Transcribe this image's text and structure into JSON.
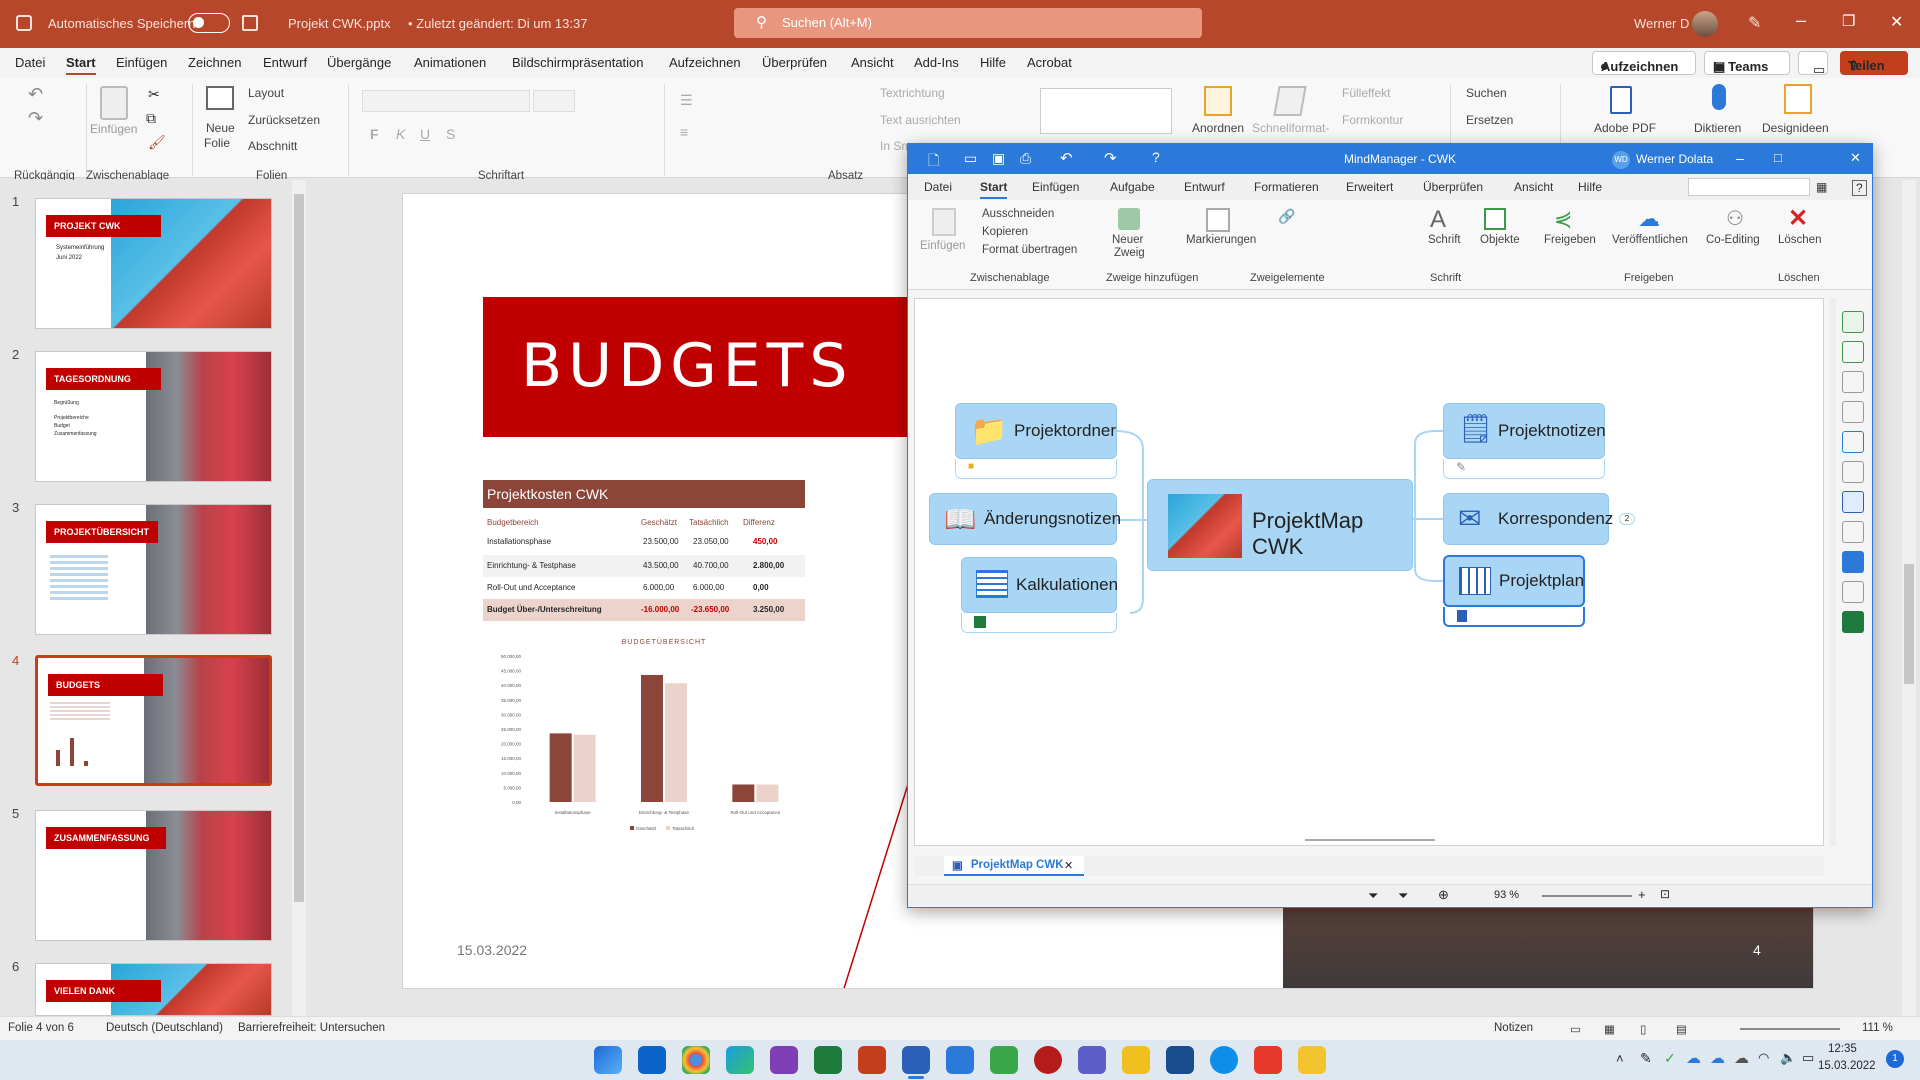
{
  "powerpoint": {
    "autosave_label": "Automatisches Speichern",
    "filename": "Projekt CWK.pptx",
    "last_changed": "• Zuletzt geändert: Di um 13:37",
    "search_placeholder": "Suchen (Alt+M)",
    "user": "Werner D",
    "tabs": [
      "Datei",
      "Start",
      "Einfügen",
      "Zeichnen",
      "Entwurf",
      "Übergänge",
      "Animationen",
      "Bildschirmpräsentation",
      "Aufzeichnen",
      "Überprüfen",
      "Ansicht",
      "Add-Ins",
      "Hilfe",
      "Acrobat"
    ],
    "record_button": "Aufzeichnen",
    "teams_button": "In Teams",
    "share_button": "Teilen",
    "ribbon": {
      "undo_group": "Rückgängig",
      "paste_label": "Einfügen",
      "clipboard_group": "Zwischenablage",
      "new_slide": "Neue",
      "new_slide2": "Folie",
      "layout": "Layout",
      "reset": "Zurücksetzen",
      "section": "Abschnitt",
      "slides_group": "Folien",
      "font_group": "Schriftart",
      "paragraph_group": "Absatz",
      "text_direction": "Textrichtung",
      "align_text": "Text ausrichten",
      "convert_smartart": "In Sm",
      "arrange": "Anordnen",
      "quick_format": "Schnellformat-",
      "fill_effect": "Fülleffekt",
      "outline": "Formkontur",
      "search": "Suchen",
      "replace": "Ersetzen",
      "adobe_pdf": "Adobe PDF",
      "dictate": "Diktieren",
      "designer": "Designideen"
    },
    "thumbnails": [
      {
        "num": "1",
        "title": "PROJEKT CWK",
        "lines": [
          "Systemeinführung",
          "Juni 2022"
        ]
      },
      {
        "num": "2",
        "title": "TAGESORDNUNG",
        "lines": [
          "Begrüßung",
          "Projektbereiche",
          "Budget",
          "Zusammenfassung"
        ]
      },
      {
        "num": "3",
        "title": "PROJEKTÜBERSICHT",
        "lines": []
      },
      {
        "num": "4",
        "title": "BUDGETS",
        "lines": []
      },
      {
        "num": "5",
        "title": "ZUSAMMENFASSUNG",
        "lines": []
      },
      {
        "num": "6",
        "title": "VIELEN DANK",
        "lines": []
      }
    ],
    "slide": {
      "title": "BUDGETS",
      "table_title": "Projektkosten CWK",
      "columns": [
        "Budgetbereich",
        "Geschätzt",
        "Tatsächlich",
        "Differenz"
      ],
      "rows": [
        [
          "Installationsphase",
          "23.500,00",
          "23.050,00",
          "450,00"
        ],
        [
          "Einrichtung- & Testphase",
          "43.500,00",
          "40.700,00",
          "2.800,00"
        ],
        [
          "Roll-Out und Acceptance",
          "6.000,00",
          "6.000,00",
          "0,00"
        ],
        [
          "Budget Über-/Unterschreitung",
          "-16.000,00",
          "-23.650,00",
          "3.250,00"
        ]
      ],
      "date": "15.03.2022",
      "page": "4"
    },
    "status": {
      "slide_of": "Folie 4 von 6",
      "language": "Deutsch (Deutschland)",
      "accessibility": "Barrierefreiheit: Untersuchen",
      "notes": "Notizen",
      "zoom": "111 %"
    }
  },
  "chart_data": {
    "type": "bar",
    "title": "BUDGETÜBERSICHT",
    "categories": [
      "Installationsphase",
      "Einrichtung- & Testphase",
      "Roll-Out und Acceptance"
    ],
    "series": [
      {
        "name": "Geschätzt",
        "values": [
          23500,
          43500,
          6000
        ],
        "color": "#8b4539"
      },
      {
        "name": "Tatsächlich",
        "values": [
          23050,
          40700,
          6000
        ],
        "color": "#ebd3cc"
      }
    ],
    "ylim": [
      0,
      50000
    ],
    "yticks": [
      "50.000,00",
      "45.000,00",
      "40.000,00",
      "35.000,00",
      "30.000,00",
      "25.000,00",
      "20.000,00",
      "15.000,00",
      "10.000,00",
      "5.000,00",
      "0,00"
    ],
    "legend": "bottom"
  },
  "mindmanager": {
    "title": "MindManager - CWK",
    "user_initials": "WD",
    "user": "Werner Dolata",
    "tabs": [
      "Datei",
      "Start",
      "Einfügen",
      "Aufgabe",
      "Entwurf",
      "Formatieren",
      "Erweitert",
      "Überprüfen",
      "Ansicht",
      "Hilfe"
    ],
    "ribbon": {
      "paste": "Einfügen",
      "cut": "Ausschneiden",
      "copy": "Kopieren",
      "format_painter": "Format übertragen",
      "clipboard_group": "Zwischenablage",
      "new_branch": "Neuer",
      "new_branch2": "Zweig",
      "add_branches_group": "Zweige hinzufügen",
      "markers": "Markierungen",
      "branch_elements_group": "Zweigelemente",
      "font": "Schrift",
      "font_group": "Schrift",
      "objects": "Objekte",
      "share": "Freigeben",
      "publish": "Veröffentlichen",
      "coediting": "Co-Editing",
      "share_group": "Freigeben",
      "delete": "Löschen",
      "delete_group": "Löschen"
    },
    "central_topic": "ProjektMap CWK",
    "topics_left": [
      "Projektordner",
      "Änderungsnotizen",
      "Kalkulationen"
    ],
    "topics_right": [
      "Projektnotizen",
      "Korrespondenz",
      "Projektplan"
    ],
    "collapsed_count": "2",
    "doc_tab": "ProjektMap CWK",
    "zoom": "93 %"
  },
  "taskbar": {
    "time": "12:35",
    "date": "15.03.2022",
    "notification_count": "1"
  }
}
